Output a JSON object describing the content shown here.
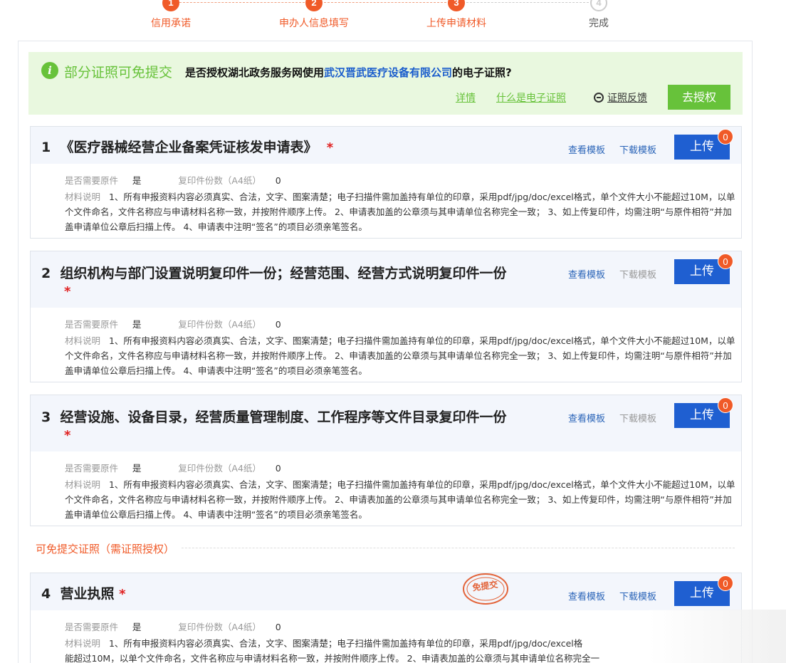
{
  "stepper": {
    "steps": [
      {
        "num": "1",
        "label": "信用承诺",
        "active": true
      },
      {
        "num": "2",
        "label": "申办人信息填写",
        "active": true
      },
      {
        "num": "3",
        "label": "上传申请材料",
        "active": true
      },
      {
        "num": "4",
        "label": "完成",
        "active": false
      }
    ]
  },
  "auth_banner": {
    "icon": "info-icon",
    "title": "部分证照可免提交",
    "question_prefix": "是否授权湖北政务服务网使用",
    "company": "武汉晋武医疗设备有限公司",
    "question_suffix": "的电子证照?",
    "details_link": "详情",
    "what_link": "什么是电子证照",
    "feedback_link": "证照反馈",
    "authorize_button": "去授权"
  },
  "materials": [
    {
      "index": "1",
      "title": "《医疗器械经营企业备案凭证核发申请表》",
      "required_mark": "*",
      "view_template": "查看模板",
      "download_template": "下载模板",
      "download_enabled": true,
      "upload_label": "上传",
      "upload_count": "0",
      "original_label": "是否需要原件",
      "original_value": "是",
      "copies_label": "复印件份数（A4纸）",
      "copies_value": "0",
      "desc_label": "材料说明",
      "desc_text": "1、所有申报资料内容必须真实、合法，文字、图案清楚；电子扫描件需加盖持有单位的印章，采用pdf/jpg/doc/excel格式，单个文件大小不能超过10M，以单个文件命名，文件名称应与申请材料名称一致，并按附件顺序上传。 2、申请表加盖的公章须与其申请单位名称完全一致； 3、如上传复印件，均需注明“与原件相符”并加盖申请单位公章后扫描上传。 4、申请表中注明“签名”的项目必须亲笔签名。"
    },
    {
      "index": "2",
      "title": "组织机构与部门设置说明复印件一份；经营范围、经营方式说明复印件一份",
      "required_mark": "*",
      "view_template": "查看模板",
      "download_template": "下载模板",
      "download_enabled": false,
      "upload_label": "上传",
      "upload_count": "0",
      "original_label": "是否需要原件",
      "original_value": "是",
      "copies_label": "复印件份数（A4纸）",
      "copies_value": "0",
      "desc_label": "材料说明",
      "desc_text": "1、所有申报资料内容必须真实、合法，文字、图案清楚；电子扫描件需加盖持有单位的印章，采用pdf/jpg/doc/excel格式，单个文件大小不能超过10M，以单个文件命名，文件名称应与申请材料名称一致，并按附件顺序上传。 2、申请表加盖的公章须与其申请单位名称完全一致； 3、如上传复印件，均需注明“与原件相符”并加盖申请单位公章后扫描上传。 4、申请表中注明“签名”的项目必须亲笔签名。"
    },
    {
      "index": "3",
      "title": "经营设施、设备目录，经营质量管理制度、工作程序等文件目录复印件一份",
      "required_mark": "*",
      "view_template": "查看模板",
      "download_template": "下载模板",
      "download_enabled": false,
      "upload_label": "上传",
      "upload_count": "0",
      "original_label": "是否需要原件",
      "original_value": "是",
      "copies_label": "复印件份数（A4纸）",
      "copies_value": "0",
      "desc_label": "材料说明",
      "desc_text": "1、所有申报资料内容必须真实、合法，文字、图案清楚；电子扫描件需加盖持有单位的印章，采用pdf/jpg/doc/excel格式，单个文件大小不能超过10M，以单个文件命名，文件名称应与申请材料名称一致，并按附件顺序上传。 2、申请表加盖的公章须与其申请单位名称完全一致； 3、如上传复印件，均需注明“与原件相符”并加盖申请单位公章后扫描上传。 4、申请表中注明“签名”的项目必须亲笔签名。"
    }
  ],
  "exempt_section": {
    "title": "可免提交证照（需证照授权）"
  },
  "exempt_material": {
    "index": "4",
    "title": "营业执照",
    "required_mark": "*",
    "stamp_text": "免提交",
    "view_template": "查看模板",
    "download_template": "下载模板",
    "upload_label": "上传",
    "upload_count": "0",
    "original_label": "是否需要原件",
    "original_value": "是",
    "copies_label": "复印件份数（A4纸）",
    "copies_value": "0",
    "desc_label": "材料说明",
    "desc_text_line1": "1、所有申报资料内容必须真实、合法，文字、图案清楚；电子扫描件需加盖持有单位的印章，采用pdf/jpg/doc/excel格",
    "desc_text_line2": "能超过10M，以单个文件命名，文件名称应与申请材料名称一致，并按附件顺序上传。 2、申请表加盖的公章须与其申请单位名称完全一"
  },
  "colors": {
    "accent_orange": "#f05a28",
    "green": "#67c23a",
    "upload_blue": "#1f5fd1",
    "link_blue": "#2a64b8"
  }
}
